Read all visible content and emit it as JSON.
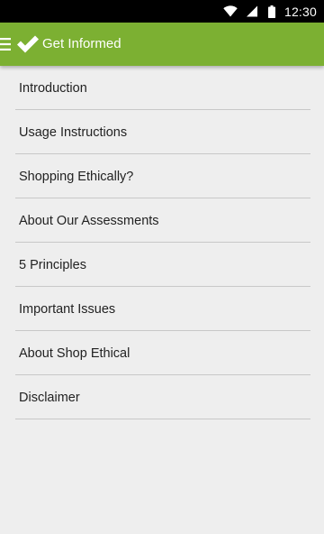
{
  "status_bar": {
    "time": "12:30",
    "icons": [
      "wifi-icon",
      "signal-icon",
      "battery-icon"
    ]
  },
  "app_bar": {
    "title": "Get Informed",
    "nav_icon": "menu-icon",
    "logo_icon": "checkmark-icon",
    "background_color": "#7cb032"
  },
  "menu": {
    "items": [
      {
        "label": "Introduction"
      },
      {
        "label": "Usage Instructions"
      },
      {
        "label": "Shopping Ethically?"
      },
      {
        "label": "About Our Assessments"
      },
      {
        "label": "5 Principles"
      },
      {
        "label": "Important Issues"
      },
      {
        "label": "About Shop Ethical"
      },
      {
        "label": "Disclaimer"
      }
    ]
  }
}
